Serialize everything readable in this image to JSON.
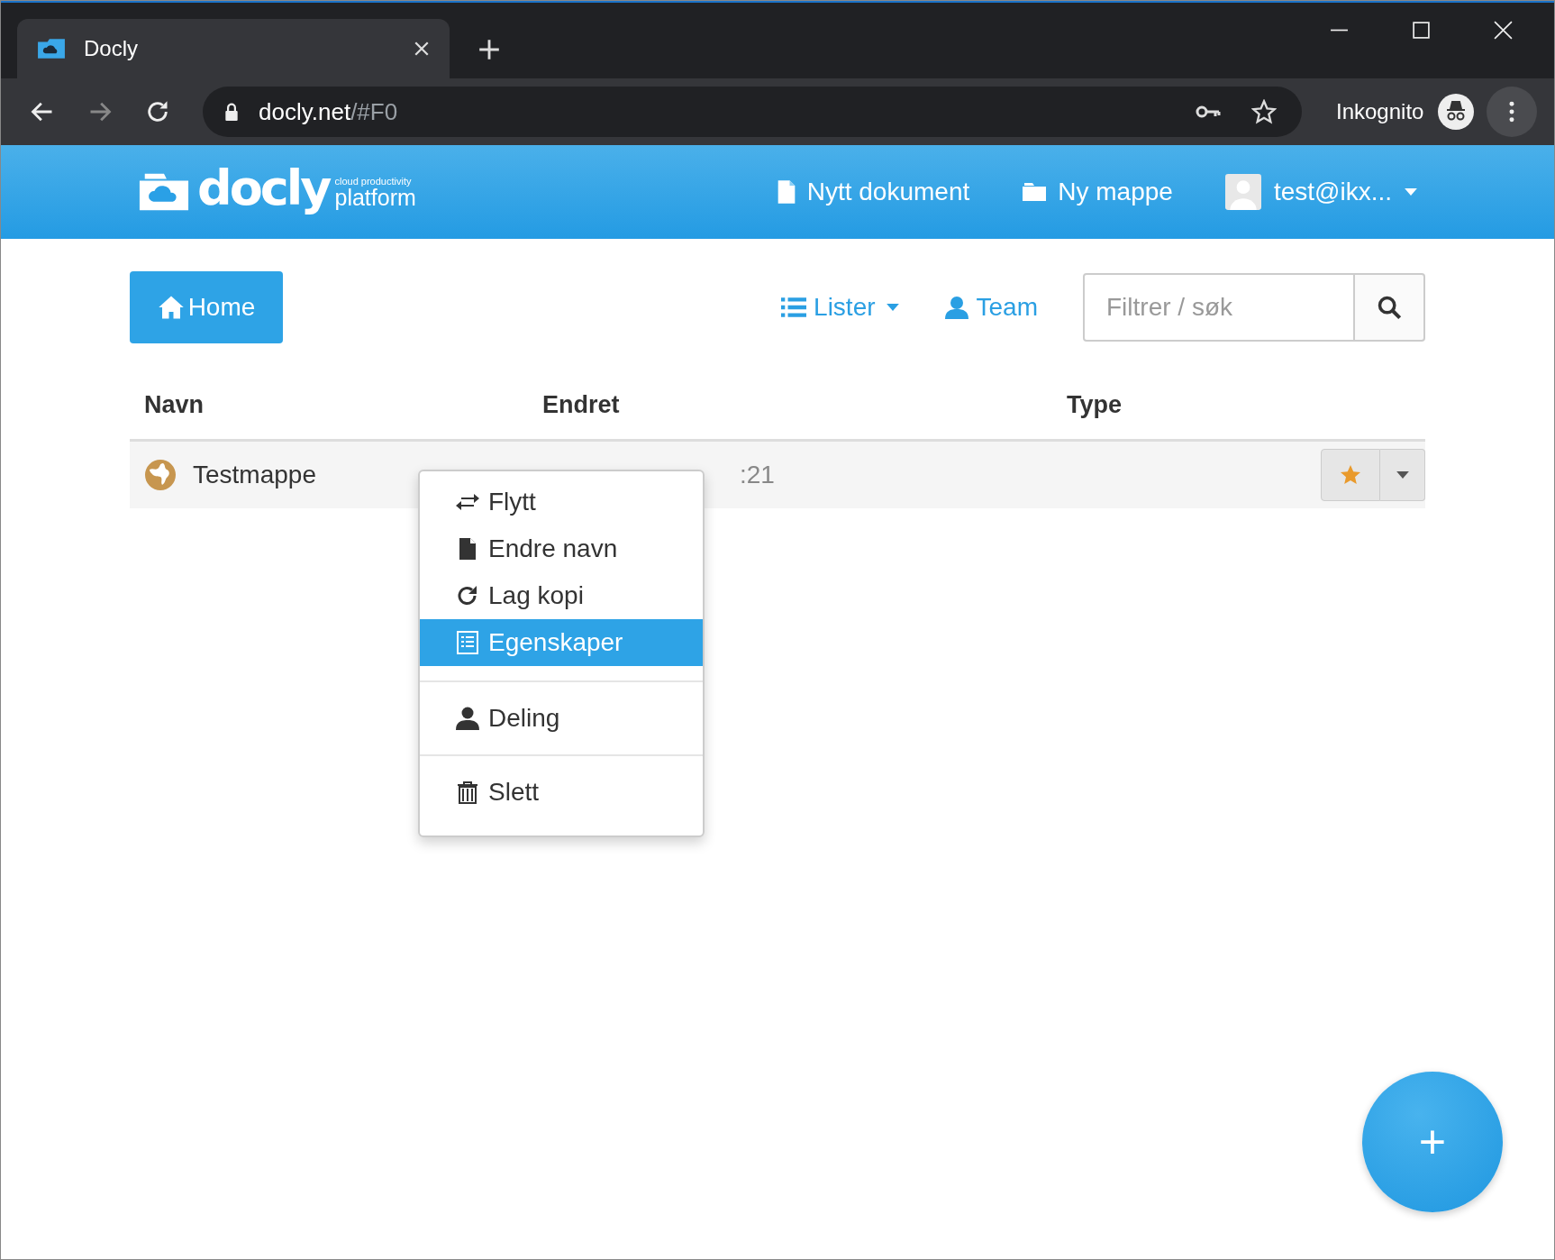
{
  "browser": {
    "tab_title": "Docly",
    "url_host": "docly.net",
    "url_path": "/#F0",
    "profile_label": "Inkognito"
  },
  "header": {
    "logo_word": "docly",
    "logo_tagline": "cloud productivity",
    "logo_sub": "platform",
    "actions": [
      {
        "label": "Nytt dokument",
        "kind": "document"
      },
      {
        "label": "Ny mappe",
        "kind": "folder"
      }
    ],
    "user": "test@ikx..."
  },
  "toolbar": {
    "home": "Home",
    "lister": "Lister",
    "team": "Team",
    "search": {
      "placeholder": "Filtrer / søk"
    }
  },
  "table": {
    "columns": [
      "Navn",
      "Endret",
      "Type"
    ],
    "rows": [
      {
        "name": "Testmappe",
        "modified": ":21",
        "starred": true
      }
    ]
  },
  "context_menu": {
    "groups": [
      [
        {
          "label": "Flytt",
          "kind": "move",
          "selected": false
        },
        {
          "label": "Endre navn",
          "kind": "rename",
          "selected": false
        },
        {
          "label": "Lag kopi",
          "kind": "copy",
          "selected": false
        },
        {
          "label": "Egenskaper",
          "kind": "properties",
          "selected": true
        }
      ],
      [
        {
          "label": "Deling",
          "kind": "share",
          "selected": false
        }
      ],
      [
        {
          "label": "Slett",
          "kind": "delete",
          "selected": false
        }
      ]
    ]
  },
  "fab": {
    "label": "+"
  }
}
